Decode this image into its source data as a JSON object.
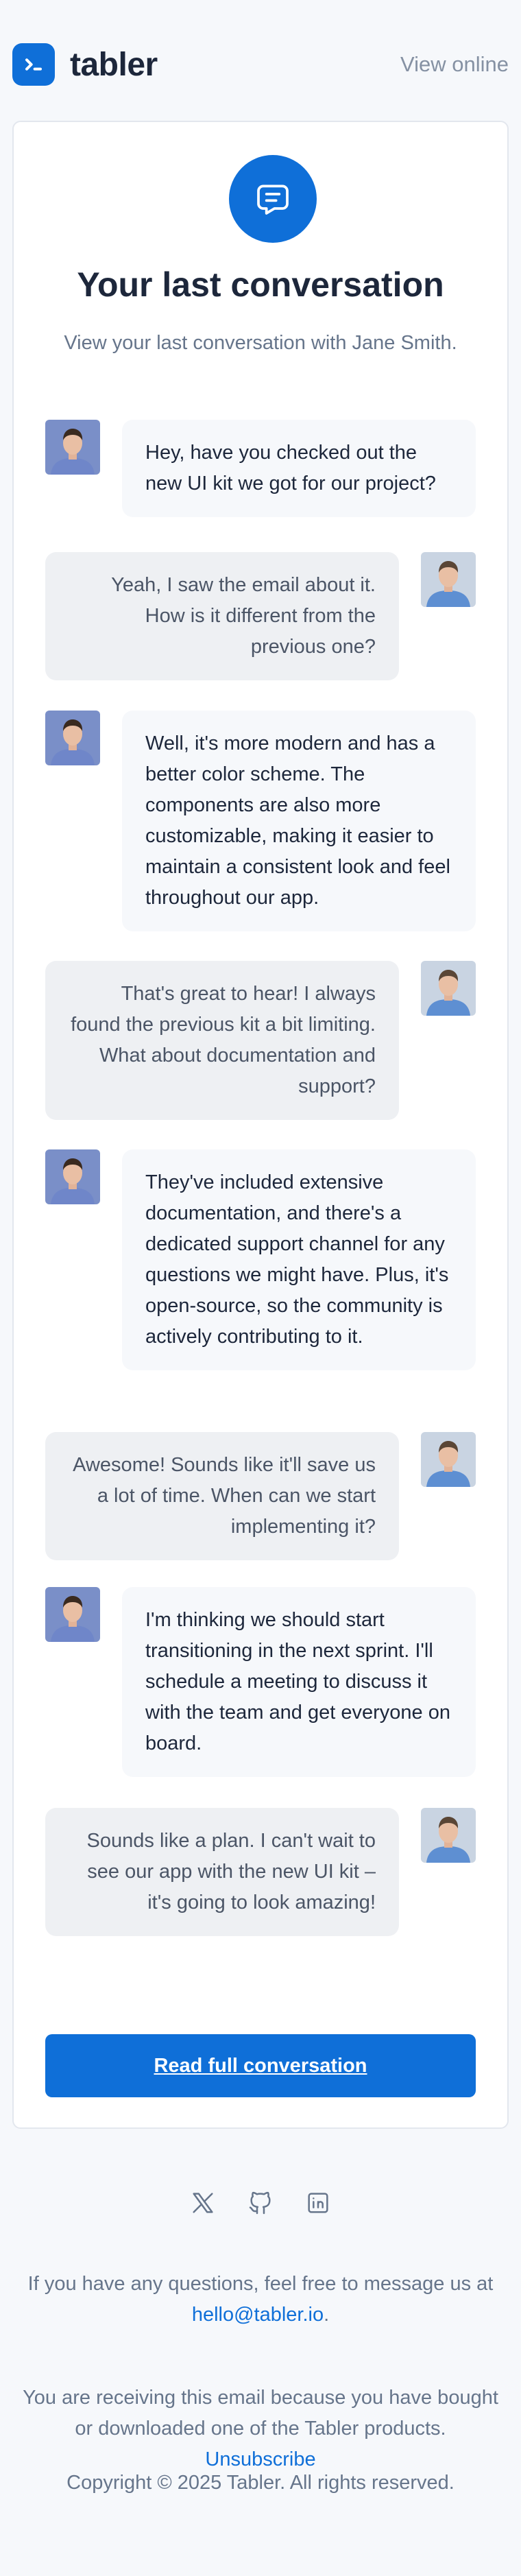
{
  "header": {
    "brand_name": "tabler",
    "view_online": "View online"
  },
  "hero": {
    "icon": "message-icon",
    "title": "Your last conversation",
    "subtitle": "View your last conversation with Jane Smith."
  },
  "messages": [
    {
      "side": "left",
      "avatar": "avatar-man-smiling",
      "text": "Hey, have you checked out the new UI kit we got for our project?"
    },
    {
      "side": "right",
      "avatar": "avatar-man-blue-shirt",
      "text": "Yeah, I saw the email about it. How is it different from the previous one?"
    },
    {
      "side": "left",
      "avatar": "avatar-man-smiling",
      "text": "Well, it's more modern and has a better color scheme. The components are also more customizable, making it easier to maintain a consistent look and feel throughout our app."
    },
    {
      "side": "right",
      "avatar": "avatar-man-blue-shirt",
      "text": "That's great to hear! I always found the previous kit a bit limiting. What about documentation and support?"
    },
    {
      "side": "left",
      "avatar": "avatar-man-smiling",
      "text": "They've included extensive documentation, and there's a dedicated support channel for any questions we might have. Plus, it's open-source, so the community is actively contributing to it."
    },
    {
      "side": "right",
      "avatar": "avatar-man-blue-shirt",
      "text": "Awesome! Sounds like it'll save us a lot of time. When can we start implementing it?"
    },
    {
      "side": "left",
      "avatar": "avatar-man-smiling",
      "text": "I'm thinking we should start transitioning in the next sprint. I'll schedule a meeting to discuss it with the team and get everyone on board."
    },
    {
      "side": "right",
      "avatar": "avatar-man-blue-shirt",
      "text": "Sounds like a plan. I can't wait to see our app with the new UI kit – it's going to look amazing!"
    }
  ],
  "cta": {
    "label": "Read full conversation"
  },
  "social": [
    "x-icon",
    "github-icon",
    "linkedin-icon"
  ],
  "footer": {
    "questions_text": "If you have any questions, feel free to message us at",
    "email": "hello@tabler.io",
    "email_suffix": ".",
    "receiving_text": "You are receiving this email because you have bought or downloaded one of the Tabler products.",
    "unsubscribe": "Unsubscribe",
    "copyright": "Copyright © 2025 Tabler. All rights reserved."
  },
  "colors": {
    "accent": "#0f6fd8",
    "text": "#1d273b",
    "muted": "#66758b",
    "background": "#f6f8fb"
  }
}
